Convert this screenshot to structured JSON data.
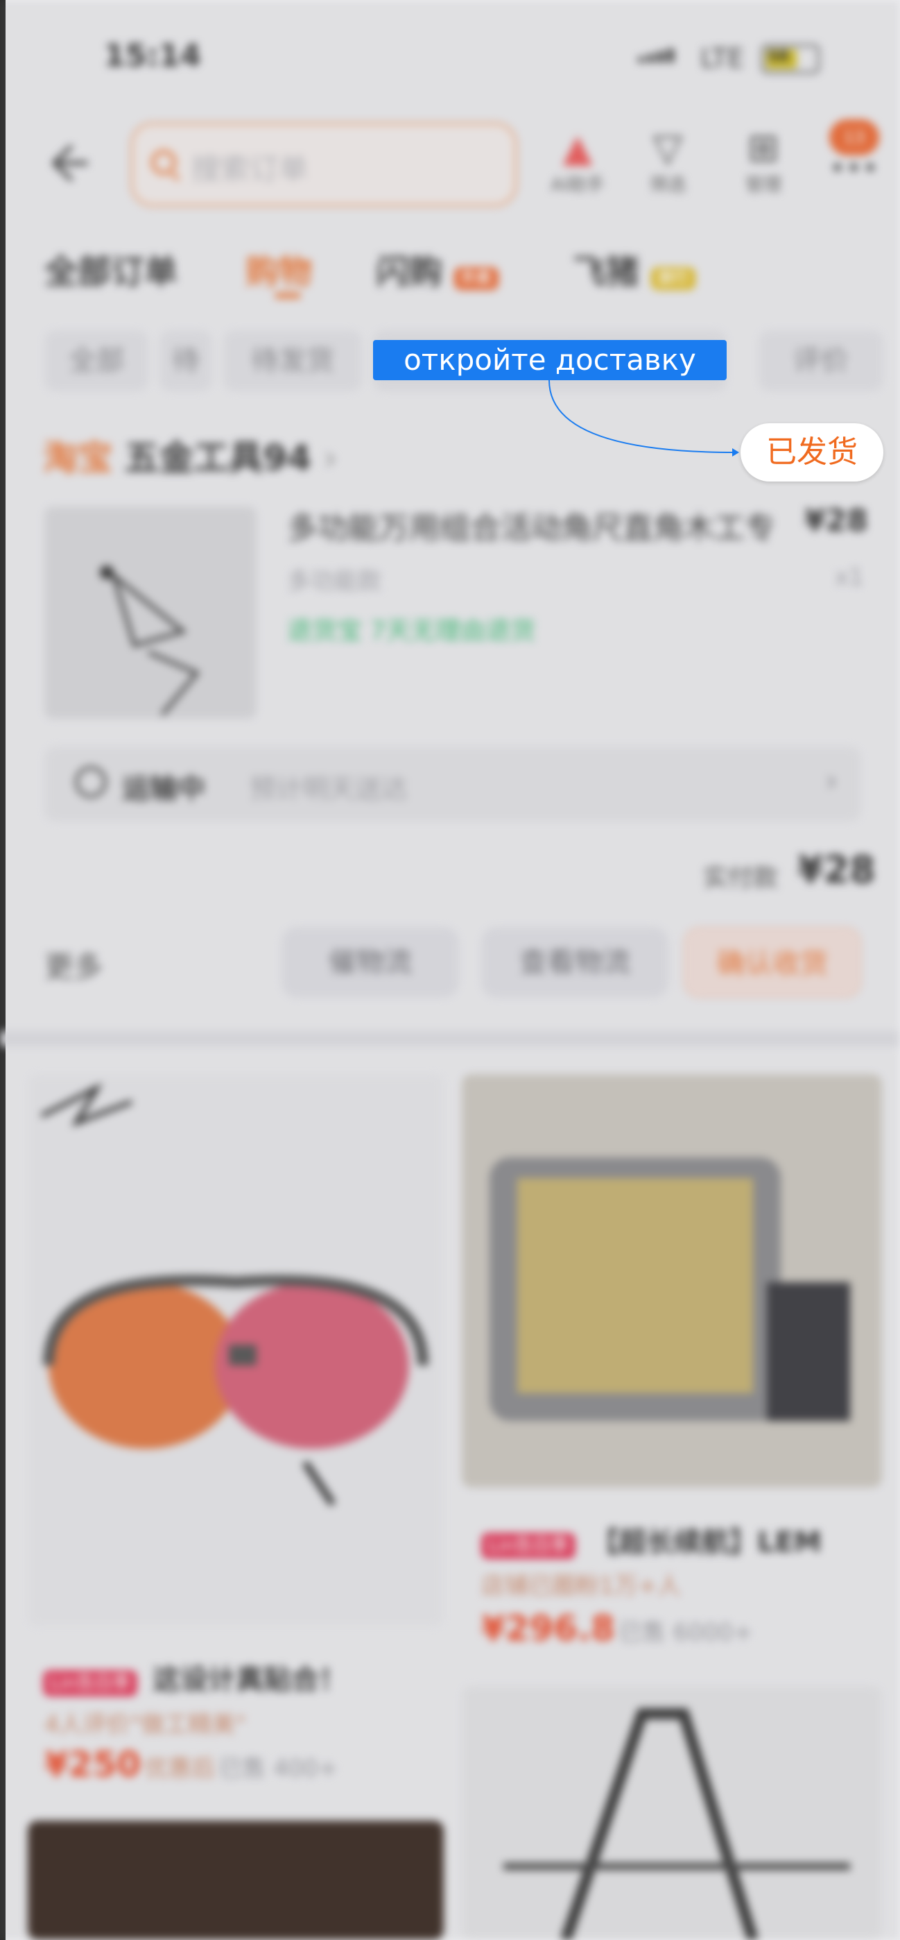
{
  "status": {
    "time": "15:14",
    "network": "LTE",
    "battery": "58"
  },
  "header": {
    "search_placeholder": "搜索订单",
    "tools": [
      {
        "label": "AI助手",
        "icon": "ai-assistant-icon"
      },
      {
        "label": "筛选",
        "icon": "filter-icon"
      },
      {
        "label": "管理",
        "icon": "grid-manage-icon"
      }
    ],
    "cart_badge": "13"
  },
  "tabs": [
    {
      "label": "全部订单"
    },
    {
      "label": "购物"
    },
    {
      "label": "闪购",
      "badge": "外卖"
    },
    {
      "label": "飞猪",
      "badge": "旅行"
    }
  ],
  "chips": [
    "全部",
    "待付款",
    "待发货",
    "已发货",
    "评价"
  ],
  "order": {
    "shop_brand": "淘宝",
    "shop_name": "五金工具94",
    "product_title": "多功能万用组合活动角尺直角木工专",
    "price": "¥28",
    "spec": "多功能款",
    "qty": "x1",
    "guarantee": "退货宝 7天无理由退货",
    "logistics_status": "运输中",
    "logistics_eta": "预计明天送达",
    "paid_label": "实付款",
    "paid_amount": "¥28",
    "more": "更多",
    "actions": [
      "催物流",
      "查看物流",
      "确认收货"
    ]
  },
  "recommendations": [
    {
      "tag": "Lin告白季",
      "title": "这设计真贴合！",
      "sub": "4人评价\"做工精美\"",
      "price": "¥250",
      "price_note": "优惠后",
      "sold": "已售 400+"
    },
    {
      "tag": "Lin告白季",
      "title": "【超长续航】LEM",
      "sub": "店铺已圈粉1万+人",
      "price": "¥296.8",
      "sold": "已售 6000+"
    }
  ],
  "overlay": {
    "instruction": "откройте доставку",
    "target": "已发货"
  }
}
